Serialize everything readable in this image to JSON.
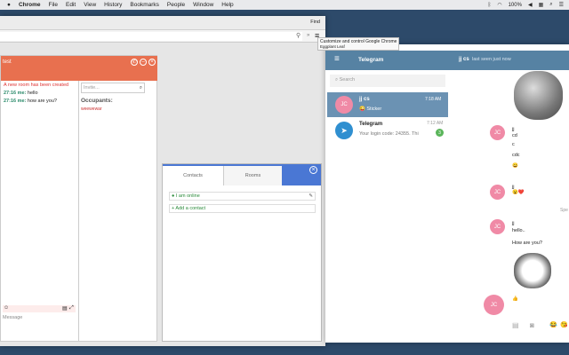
{
  "menubar": {
    "items": [
      "Chrome",
      "File",
      "Edit",
      "View",
      "History",
      "Bookmarks",
      "People",
      "Window",
      "Help"
    ],
    "battery": "100%"
  },
  "browser": {
    "find_label": "Find",
    "tooltip": "Customize and control Google Chrome",
    "sub_tooltip": "Eggplant Leaf"
  },
  "room": {
    "title": "test",
    "system_msg": "A new room has been created",
    "messages": [
      {
        "time": "27:16 me:",
        "text": "hello"
      },
      {
        "time": "27:16 me:",
        "text": "how are you?"
      }
    ],
    "invite_placeholder": "Invite...",
    "occupants_label": "Occupants:",
    "occupant": "weewewar",
    "message_placeholder": "Message"
  },
  "contacts": {
    "tabs": [
      "Contacts",
      "Rooms"
    ],
    "status": "I am online",
    "add_contact": "+ Add a contact"
  },
  "telegram": {
    "title": "Telegram",
    "search_placeholder": "Search",
    "chat_header_name": "jj cs",
    "chat_header_status": "last seen just now",
    "dialogs": [
      {
        "initials": "JC",
        "name": "jj cs",
        "time": "7:18 AM",
        "preview": "😜 Sticker",
        "active": true
      },
      {
        "initials": "",
        "name": "Telegram",
        "time": "7:12 AM",
        "preview": "Your login code: 24355. Thi",
        "badge": "3",
        "active": false
      }
    ],
    "messages": [
      {
        "initials": "JC",
        "author": "jj",
        "lines": [
          "cd",
          "c",
          "cdc",
          "😀"
        ]
      },
      {
        "initials": "JC",
        "author": "jj",
        "lines": [
          "😮❤️"
        ]
      },
      {
        "initials": "JC",
        "author": "jj",
        "lines": [
          "hello..",
          "How are you?"
        ]
      },
      {
        "initials": "JC",
        "author": "",
        "lines": [
          "👍"
        ]
      }
    ],
    "side_label": "Spe"
  },
  "colors": {
    "orange": "#e8704f",
    "telegram_blue": "#5682a3",
    "accent_blue": "#4a77d4"
  }
}
